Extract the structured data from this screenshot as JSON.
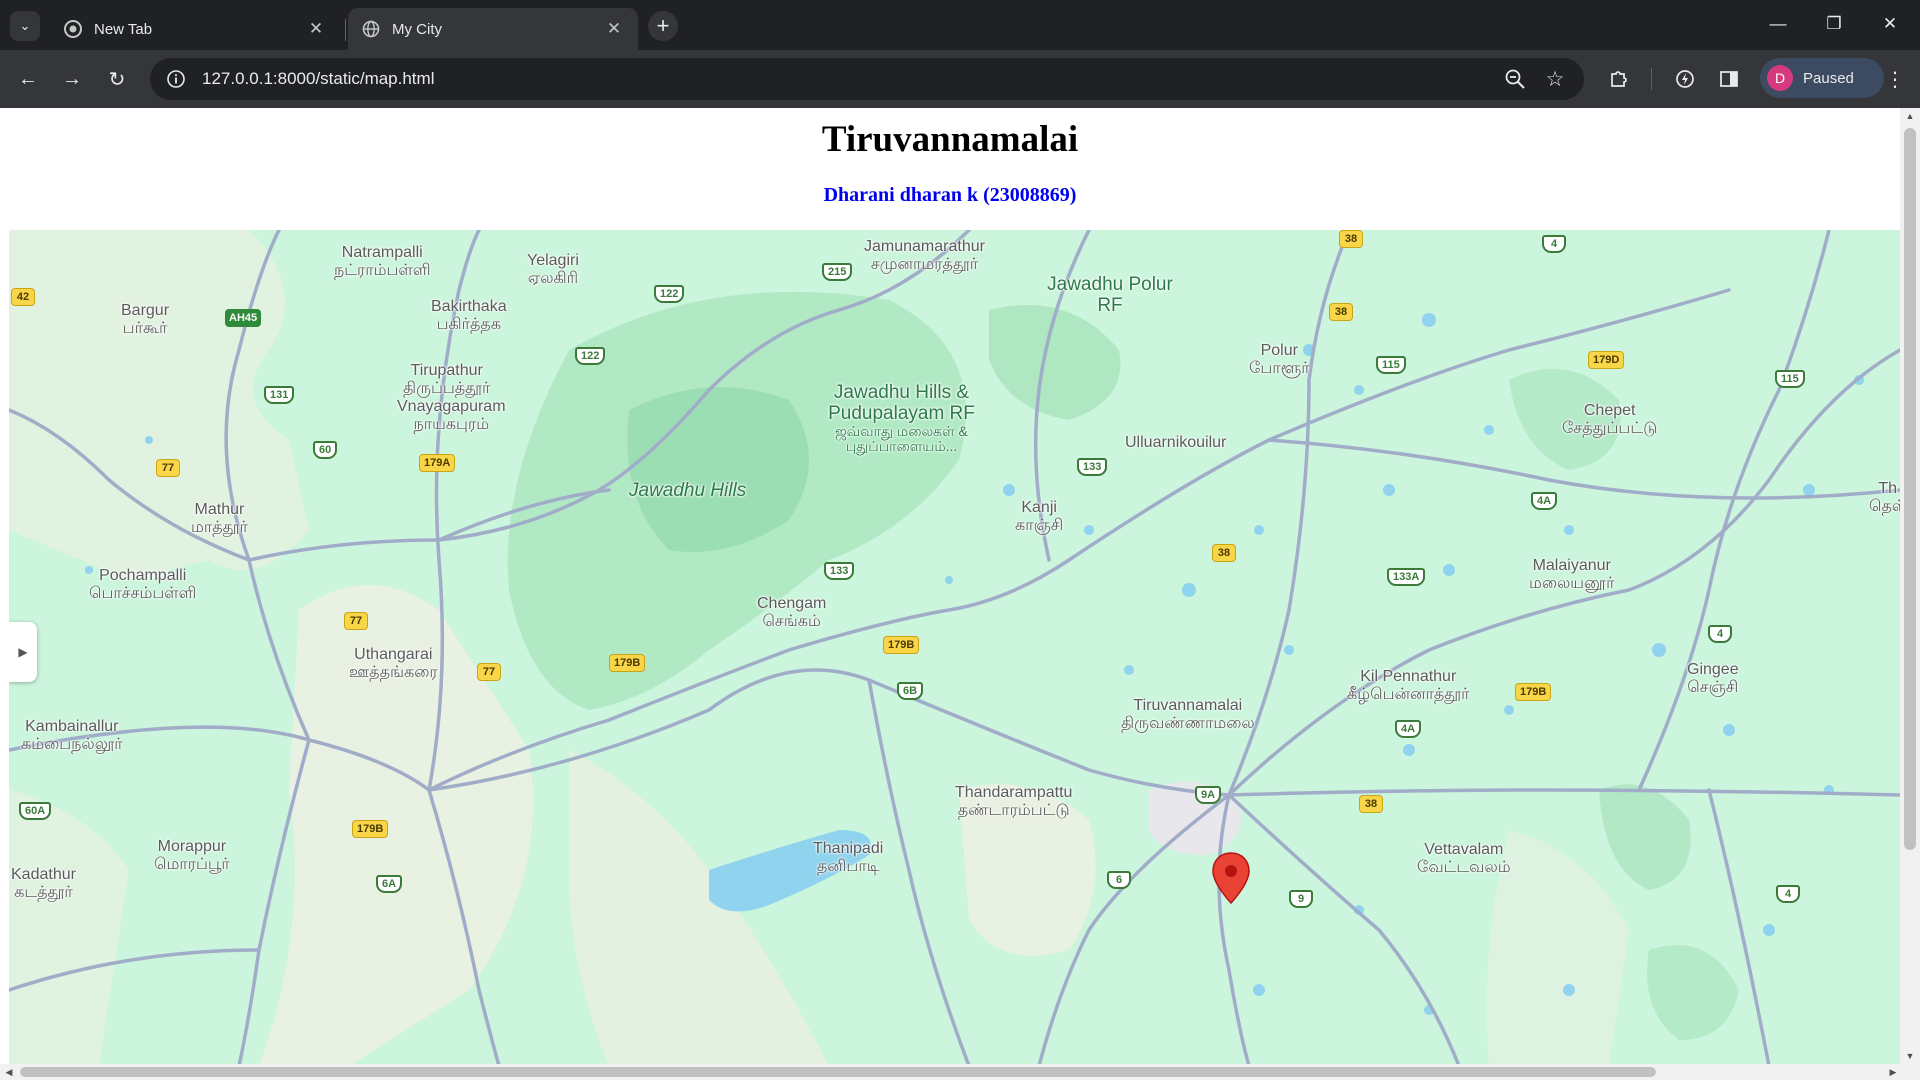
{
  "browser": {
    "tabs": [
      {
        "title": "New Tab",
        "active": false,
        "icon": "chrome-icon"
      },
      {
        "title": "My City",
        "active": true,
        "icon": "globe-icon"
      }
    ],
    "url": "127.0.0.1:8000/static/map.html",
    "profile": {
      "initial": "D",
      "status": "Paused"
    }
  },
  "page": {
    "title": "Tiruvannamalai",
    "subtitle": "Dharani dharan k (23008869)"
  },
  "map": {
    "marker": "Tiruvannamalai",
    "places": [
      {
        "en": "Natrampalli",
        "ta": "நட்ராம்பள்ளி"
      },
      {
        "en": "Yelagiri",
        "ta": "ஏலகிரி"
      },
      {
        "en": "Jamunamarathur",
        "ta": "சமுனாமரத்தூர்"
      },
      {
        "en": "Jawadhu Polur RF",
        "ta": ""
      },
      {
        "en": "Bargur",
        "ta": "பர்கூர்"
      },
      {
        "en": "Bakirthaka",
        "ta": "பகிர்த்தக"
      },
      {
        "en": "Tirupathur",
        "ta": "திருப்பத்தூர்"
      },
      {
        "en": "Vnayagapuram",
        "ta": "நாயகபுரம்"
      },
      {
        "en": "Jawadhu Hills & Pudupalayam RF",
        "ta": "ஜவ்வாது மலைகள் & புதுப்பாளையம்..."
      },
      {
        "en": "Polur",
        "ta": "போளூர்"
      },
      {
        "en": "Chepet",
        "ta": "சேத்துப்பட்டு"
      },
      {
        "en": "Ulluarnikouilur",
        "ta": ""
      },
      {
        "en": "Jawadhu Hills",
        "ta": ""
      },
      {
        "en": "Mathur",
        "ta": "மாத்தூர்"
      },
      {
        "en": "Kanji",
        "ta": "காஞ்சி"
      },
      {
        "en": "Pochampalli",
        "ta": "பொச்சம்பள்ளி"
      },
      {
        "en": "Chengam",
        "ta": "செங்கம்"
      },
      {
        "en": "Malaiyanur",
        "ta": "மலையனூர்"
      },
      {
        "en": "Uthangarai",
        "ta": "ஊத்தங்கரை"
      },
      {
        "en": "Kil Pennathur",
        "ta": "கீழ்பென்னாத்தூர்"
      },
      {
        "en": "Gingee",
        "ta": "செஞ்சி"
      },
      {
        "en": "Tiruvannamalai",
        "ta": "திருவண்ணாமலை"
      },
      {
        "en": "Kambainallur",
        "ta": "கம்பைநல்லூர்"
      },
      {
        "en": "Thandarampattu",
        "ta": "தண்டாரம்பட்டு"
      },
      {
        "en": "Morappur",
        "ta": "மொரப்பூர்"
      },
      {
        "en": "Thanipadi",
        "ta": "தனிபாடி"
      },
      {
        "en": "Vettavalam",
        "ta": "வேட்டவலம்"
      },
      {
        "en": "Kadathur",
        "ta": "கடத்தூர்"
      },
      {
        "en": "Th",
        "ta": "தெள்"
      }
    ],
    "road_labels": [
      "42",
      "AH45",
      "215",
      "122",
      "38",
      "38",
      "4",
      "131",
      "122",
      "115",
      "179D",
      "115",
      "60",
      "77",
      "179A",
      "133",
      "4A",
      "133",
      "38",
      "133A",
      "77",
      "179B",
      "179B",
      "77",
      "6B",
      "4",
      "179B",
      "4A",
      "60A",
      "179B",
      "6A",
      "9A",
      "38",
      "6",
      "9",
      "4"
    ]
  }
}
